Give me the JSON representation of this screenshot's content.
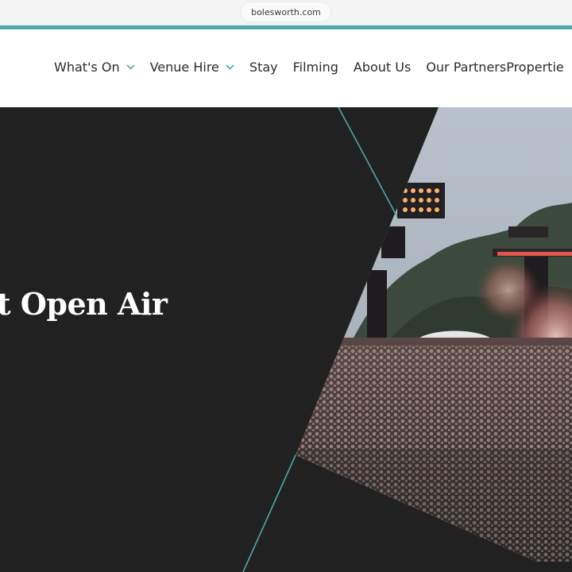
{
  "browser": {
    "url": "bolesworth.com"
  },
  "colors": {
    "accent": "#4ea7a8",
    "dark": "#222121",
    "nav_text": "#2b2b2b"
  },
  "nav": {
    "items": [
      {
        "label": "What's On",
        "has_dropdown": true
      },
      {
        "label": "Venue Hire",
        "has_dropdown": true
      },
      {
        "label": "Stay",
        "has_dropdown": false
      },
      {
        "label": "Filming",
        "has_dropdown": false
      },
      {
        "label": "About Us",
        "has_dropdown": false
      },
      {
        "label": "Our Partners",
        "has_dropdown": false
      },
      {
        "label": "Propertie",
        "has_dropdown": false
      }
    ]
  },
  "hero": {
    "title": "t Open Air",
    "image": "festival-crowd-stage-photo"
  }
}
